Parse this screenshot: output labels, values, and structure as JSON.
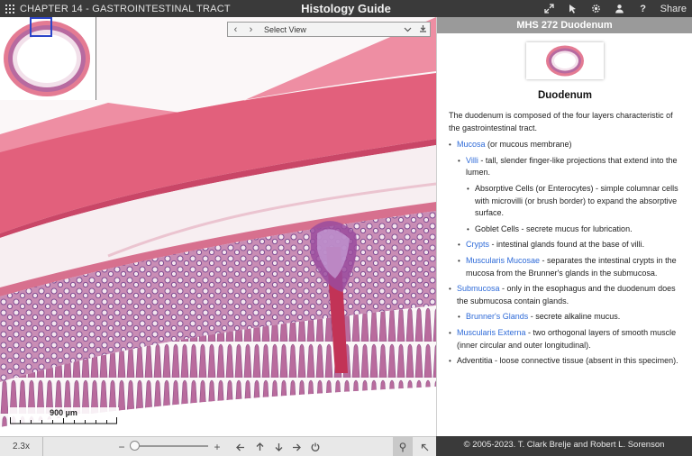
{
  "topbar": {
    "chapter": "CHAPTER 14 - GASTROINTESTINAL TRACT",
    "title": "Histology Guide",
    "share_label": "Share",
    "tool_icons": [
      "fullscreen-icon",
      "pointer-icon",
      "gear-icon",
      "user-icon",
      "help-icon"
    ]
  },
  "viewer": {
    "select_view_label": "Select View",
    "scale_label": "900 µm"
  },
  "bottombar": {
    "zoom_level": "2.3x",
    "zoom_slider_fraction": 0.05
  },
  "panel": {
    "header": "MHS 272 Duodenum",
    "heading": "Duodenum",
    "intro": "The duodenum is composed of the four layers characteristic of the gastrointestinal tract.",
    "items": [
      {
        "link": "Mucosa",
        "text": " (or mucous membrane)",
        "children": [
          {
            "link": "Villi",
            "text": " - tall, slender finger-like projections that extend into the lumen.",
            "children": [
              {
                "text": "Absorptive Cells (or Enterocytes) - simple columnar cells with microvilli (or brush border) to expand the absorptive surface."
              },
              {
                "text": "Goblet Cells - secrete mucus for lubrication."
              }
            ]
          },
          {
            "link": "Crypts",
            "text": " - intestinal glands found at the base of villi."
          },
          {
            "link": "Muscularis Mucosae",
            "text": " - separates the intestinal crypts in the mucosa from the Brunner's glands in the submucosa."
          }
        ]
      },
      {
        "link": "Submucosa",
        "text": " - only in the esophagus and the duodenum does the submucosa contain glands.",
        "children": [
          {
            "link": "Brunner's Glands",
            "text": " - secrete alkaline mucus."
          }
        ]
      },
      {
        "link": "Muscularis Externa",
        "text": " - two orthogonal layers of smooth muscle (inner circular and outer longitudinal)."
      },
      {
        "text": "Adventitia - loose connective tissue (absent in this specimen)."
      }
    ]
  },
  "copyright": "© 2005-2023. T. Clark Brelje and Robert L. Sorenson",
  "colors": {
    "topbar": "#3a3a3a",
    "muscle": "#e2607c",
    "muscle_dark": "#d14b69",
    "mucosa": "#b97aa8",
    "gland": "#8d5a9a",
    "submucosa": "#f7eef1",
    "link": "#2f6bd8"
  }
}
